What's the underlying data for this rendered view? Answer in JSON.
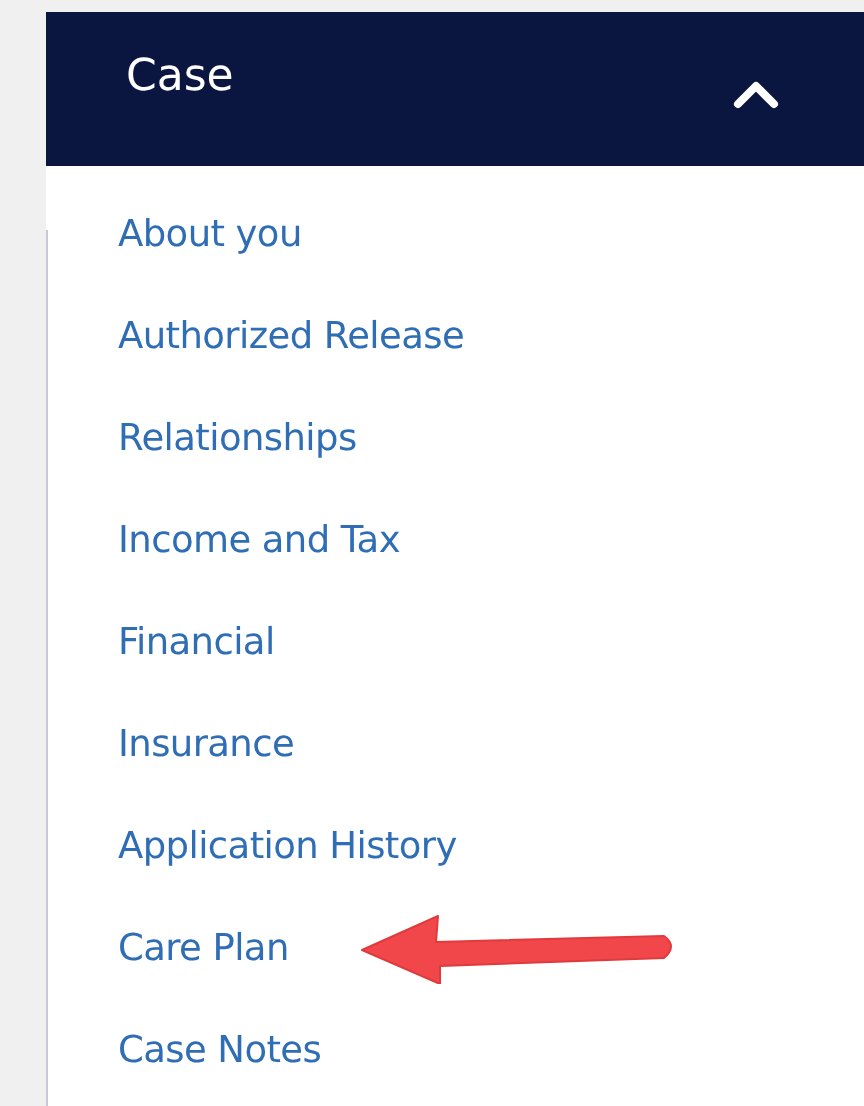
{
  "section": {
    "title": "Case",
    "expanded": true
  },
  "links": [
    {
      "label": "About you",
      "arrow": false
    },
    {
      "label": "Authorized Release",
      "arrow": false
    },
    {
      "label": "Relationships",
      "arrow": false
    },
    {
      "label": "Income and Tax",
      "arrow": false
    },
    {
      "label": "Financial",
      "arrow": false
    },
    {
      "label": "Insurance",
      "arrow": false
    },
    {
      "label": "Application History",
      "arrow": false
    },
    {
      "label": "Care Plan",
      "arrow": true
    },
    {
      "label": "Case Notes",
      "arrow": false
    }
  ]
}
